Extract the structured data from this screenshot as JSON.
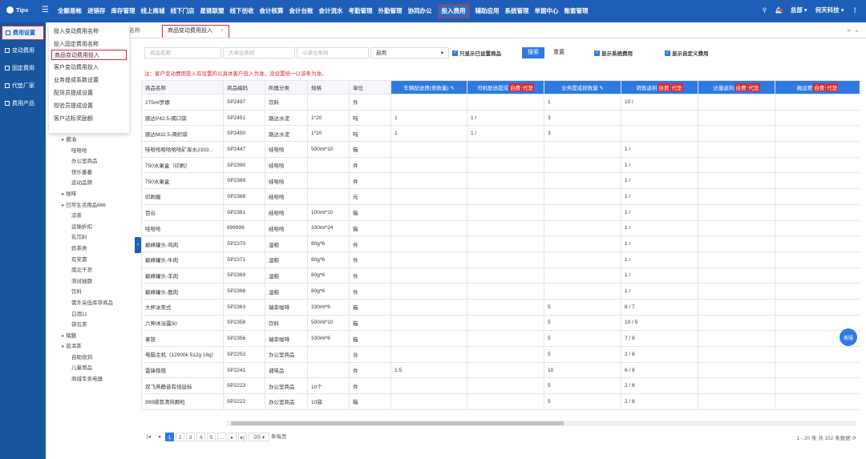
{
  "topbar": {
    "brand": "Tips",
    "menu": [
      "全额易帐",
      "进销存",
      "库存管理",
      "线上商城",
      "线下门店",
      "星链联盟",
      "线下创收",
      "会计核算",
      "会计台账",
      "会计流水",
      "考勤管理",
      "外勤管理",
      "协同办公",
      "投入费用",
      "辅助应用",
      "系统管理",
      "单据中心",
      "账套管理"
    ],
    "active_menu": "投入费用",
    "user": "总部",
    "company": "何天科技"
  },
  "sidebar": [
    "费用设置",
    "变动费用",
    "固定费用",
    "代垫厂家",
    "费用产品"
  ],
  "popup": [
    "投入变动费用名称",
    "投入固定费用名称",
    "商品变动费用投入",
    "客户变动费用投入",
    "业务提成系数设置",
    "配货员提成设置",
    "校验员提成设置",
    "客户达标奖励额"
  ],
  "tabs": {
    "prev": "名称",
    "active": "商品变动费用投入"
  },
  "tree": [
    {
      "t": "酱油",
      "p": true
    },
    {
      "t": "哇哈哈"
    },
    {
      "t": "办公室商品"
    },
    {
      "t": "快乐番番"
    },
    {
      "t": "运动品牌"
    },
    {
      "t": "咖啡",
      "p": true
    },
    {
      "t": "日常生活用品666",
      "p": true
    },
    {
      "t": "凉茶"
    },
    {
      "t": "运输折扣"
    },
    {
      "t": "乳饮料"
    },
    {
      "t": "奶茶类"
    },
    {
      "t": "有奖靠"
    },
    {
      "t": "南北干货"
    },
    {
      "t": "测试抽题"
    },
    {
      "t": "饮料"
    },
    {
      "t": "需外采低库存商品"
    },
    {
      "t": "白酒11"
    },
    {
      "t": "袋包茶"
    },
    {
      "t": "猪膳",
      "p": true
    },
    {
      "t": "普洱茶",
      "p": true
    },
    {
      "t": "自助烧洞"
    },
    {
      "t": "儿童用品"
    },
    {
      "t": "商城专卖电器"
    }
  ],
  "filters": {
    "name_ph": "商品名称",
    "big_ph": "大单位条码",
    "small_ph": "小单位条码",
    "status": "启用",
    "only_label": "只显示已设置商品",
    "search": "搜索",
    "reset": "重置",
    "sys_label": "显示系统费用",
    "custom_label": "显示自定义费用"
  },
  "note": "注：客户变动费用投入有设置的以具体客户投入为准，没设置统一以该条为准。",
  "columns": [
    "商品名称",
    "商品编码",
    "所属分类",
    "规格",
    "单位",
    "车辆配送费(按数量)",
    "司机配送提成",
    "业务提成按数量",
    "销售返利",
    "达量返利",
    "搬运费"
  ],
  "tags": [
    "自费",
    "代垫"
  ],
  "rows": [
    [
      "275ml罗娜",
      "SP2497",
      "饮料",
      "",
      "件",
      "",
      "",
      "1",
      "10 /",
      "",
      ""
    ],
    [
      "路达P42.5-褐口袋",
      "SP2451",
      "路达水泥",
      "1*20",
      "吨",
      "1",
      "1 /",
      "3",
      "",
      "",
      ""
    ],
    [
      "路达M32.5-褐织袋",
      "SP2450",
      "路达水泥",
      "1*20",
      "吨",
      "1",
      "1 /",
      "3",
      "",
      "",
      ""
    ],
    [
      "哇哈哈哈哈哈哈矿泉水2333...",
      "SP2447",
      "娃哈哈",
      "500ml*10",
      "箱",
      "",
      "",
      "",
      "1 /",
      "",
      ""
    ],
    [
      "750水果盒（印刷）",
      "SP2390",
      "娃哈哈",
      "",
      "件",
      "",
      "",
      "",
      "1 /",
      "",
      ""
    ],
    [
      "750水果盒",
      "SP2389",
      "娃哈哈",
      "",
      "件",
      "",
      "",
      "",
      "1 /",
      "",
      ""
    ],
    [
      "印刷瘤",
      "SP2388",
      "娃哈哈",
      "",
      "元",
      "",
      "",
      "",
      "1 /",
      "",
      ""
    ],
    [
      "百谷",
      "SP2381",
      "娃哈哈",
      "100ml*10",
      "箱",
      "",
      "",
      "",
      "1 /",
      "",
      ""
    ],
    [
      "哇哈哈",
      "999999",
      "娃哈哈",
      "330ml*24",
      "箱",
      "",
      "",
      "",
      "1 /",
      "",
      ""
    ],
    [
      "巅峰罐头-鸡肉",
      "SP2370",
      "湿粮",
      "80g*6",
      "件",
      "",
      "",
      "",
      "1 /",
      "",
      ""
    ],
    [
      "巅峰罐头-牛肉",
      "SP2371",
      "湿粮",
      "80g*6",
      "件",
      "",
      "",
      "",
      "1 /",
      "",
      ""
    ],
    [
      "巅峰罐头-羊肉",
      "SP2369",
      "湿粮",
      "80g*6",
      "件",
      "",
      "",
      "",
      "1 /",
      "",
      ""
    ],
    [
      "巅峰罐头-鹿肉",
      "SP2368",
      "湿粮",
      "80g*6",
      "件",
      "",
      "",
      "",
      "1 /",
      "",
      ""
    ],
    [
      "大杯冰美式",
      "SP2363",
      "瑞幸咖啡",
      "330ml*6",
      "箱",
      "",
      "",
      "5",
      "8 / 7",
      "",
      ""
    ],
    [
      "六神沐浴露50",
      "SP2358",
      "饮料",
      "500ml*10",
      "箱",
      "",
      "",
      "5",
      "10 / 5",
      "",
      ""
    ],
    [
      "拿铁",
      "SP2356",
      "瑞幸咖啡",
      "330ml*6",
      "箱",
      "",
      "",
      "5",
      "7 / 8",
      "",
      ""
    ],
    [
      "电脑主机（12900k 512g 16g）",
      "SP2253",
      "办公室商品",
      "",
      "台",
      "",
      "",
      "5",
      "2 / 6",
      "",
      ""
    ],
    [
      "雷锋筷筷",
      "SP2241",
      "调味品",
      "",
      "件",
      "1.5",
      "",
      "10",
      "6 / 9",
      "",
      ""
    ],
    [
      "双飞燕静音有线鼠标",
      "SP2223",
      "办公室商品",
      "10个",
      "件",
      "",
      "",
      "5",
      "2 / 6",
      "",
      ""
    ],
    [
      "999感冒清热颗粒",
      "SP2222",
      "办公室商品",
      "10袋",
      "箱",
      "",
      "",
      "5",
      "2 / 6",
      "",
      ""
    ]
  ],
  "pager": {
    "pages": [
      "1",
      "2",
      "3",
      "4",
      "5",
      "...",
      "▸",
      "▸|"
    ],
    "size": "20",
    "per_page": "条每页",
    "info": "1 - 20 条  共 152 条数据"
  },
  "kefu": "客服"
}
